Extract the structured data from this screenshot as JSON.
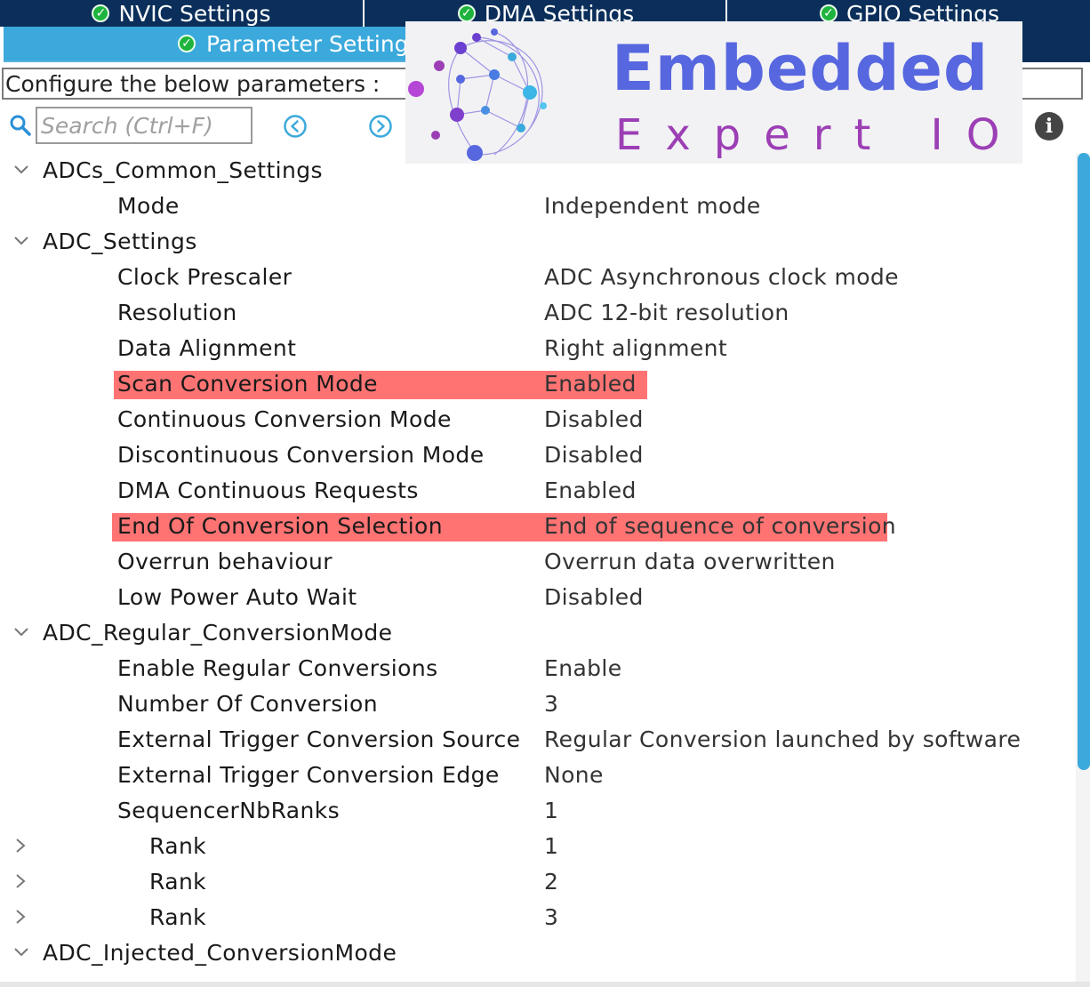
{
  "tabs": {
    "nvic": "NVIC Settings",
    "dma": "DMA Settings",
    "gpio": "GPIO Settings",
    "parameter": "Parameter Settings"
  },
  "configure_label": "Configure the below parameters :",
  "search": {
    "placeholder": "Search (Ctrl+F)"
  },
  "logo": {
    "title": "Embedded",
    "subtitle": "Expert IO"
  },
  "colors": {
    "tab_dark": "#0b2f5a",
    "tab_active": "#3ba9dc",
    "highlight": "#ff7373",
    "check": "#1db33d"
  },
  "groups": {
    "common": {
      "label": "ADCs_Common_Settings",
      "mode": {
        "label": "Mode",
        "value": "Independent mode"
      }
    },
    "adc": {
      "label": "ADC_Settings",
      "clock": {
        "label": "Clock Prescaler",
        "value": "ADC Asynchronous clock mode"
      },
      "resolution": {
        "label": "Resolution",
        "value": "ADC 12-bit resolution"
      },
      "alignment": {
        "label": "Data Alignment",
        "value": "Right alignment"
      },
      "scan": {
        "label": "Scan Conversion Mode",
        "value": "Enabled"
      },
      "continuous": {
        "label": "Continuous Conversion Mode",
        "value": "Disabled"
      },
      "discontinuous": {
        "label": "Discontinuous Conversion Mode",
        "value": "Disabled"
      },
      "dma": {
        "label": "DMA Continuous Requests",
        "value": "Enabled"
      },
      "eoc": {
        "label": "End Of Conversion Selection",
        "value": "End of sequence of conversion"
      },
      "overrun": {
        "label": "Overrun behaviour",
        "value": "Overrun data overwritten"
      },
      "lowpower": {
        "label": "Low Power Auto Wait",
        "value": "Disabled"
      }
    },
    "regular": {
      "label": "ADC_Regular_ConversionMode",
      "enable": {
        "label": "Enable Regular Conversions",
        "value": "Enable"
      },
      "number": {
        "label": "Number Of Conversion",
        "value": "3"
      },
      "trigger_source": {
        "label": "External Trigger Conversion Source",
        "value": "Regular Conversion launched by software"
      },
      "trigger_edge": {
        "label": "External Trigger Conversion Edge",
        "value": "None"
      },
      "ranks": {
        "label": "SequencerNbRanks",
        "value": "1"
      },
      "rank1": {
        "label": "Rank",
        "value": "1"
      },
      "rank2": {
        "label": "Rank",
        "value": "2"
      },
      "rank3": {
        "label": "Rank",
        "value": "3"
      }
    },
    "injected": {
      "label": "ADC_Injected_ConversionMode"
    }
  }
}
